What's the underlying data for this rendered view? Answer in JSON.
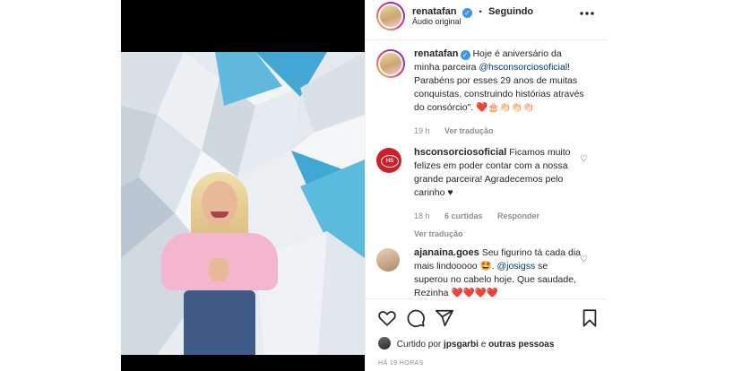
{
  "header": {
    "username": "renatafan",
    "separator": "•",
    "follow_status": "Seguindo",
    "audio": "Áudio original",
    "more_icon": "more-horizontal-icon"
  },
  "caption": {
    "username": "renatafan",
    "text_before_mention": "Hoje é aniversário da minha parceira ",
    "mention": "@hsconsorciosoficial",
    "text_after_mention": "! Parabéns por esses 29 anos de muitas conquistas, construindo histórias através do consórcio\". ❤️🎂👏🏻👏🏻👏🏻",
    "time": "19 h",
    "translate": "Ver tradução"
  },
  "comments": [
    {
      "username": "hsconsorciosoficial",
      "text": "Ficamos muito felizes em poder contar com a nossa grande parceira! Agradecemos pelo carinho ♥",
      "time": "18 h",
      "likes": "6 curtidas",
      "reply": "Responder",
      "translate": "Ver tradução",
      "avatar_text": "HS"
    },
    {
      "username": "ajanaina.goes",
      "text_before_mention": "Seu figurino tá cada dia mais lindooooo 🤩. ",
      "mention": "@josigss",
      "text_after_mention": " se superou no cabelo hoje. Que saudade, Rezinha ❤️❤️❤️❤️"
    }
  ],
  "actions": {
    "like_icon": "heart-icon",
    "comment_icon": "comment-icon",
    "share_icon": "share-icon",
    "save_icon": "bookmark-icon"
  },
  "likes": {
    "prefix": "Curtido por",
    "user": "jpsgarbi",
    "joiner": "e",
    "others": "outras pessoas"
  },
  "posted_ago": "HÁ 19 HORAS",
  "colors": {
    "verified": "#3897f0",
    "link": "#00376b",
    "muted": "#8e8e8e",
    "hs_brand": "#d21f26",
    "shirt": "#f4b6cf"
  }
}
